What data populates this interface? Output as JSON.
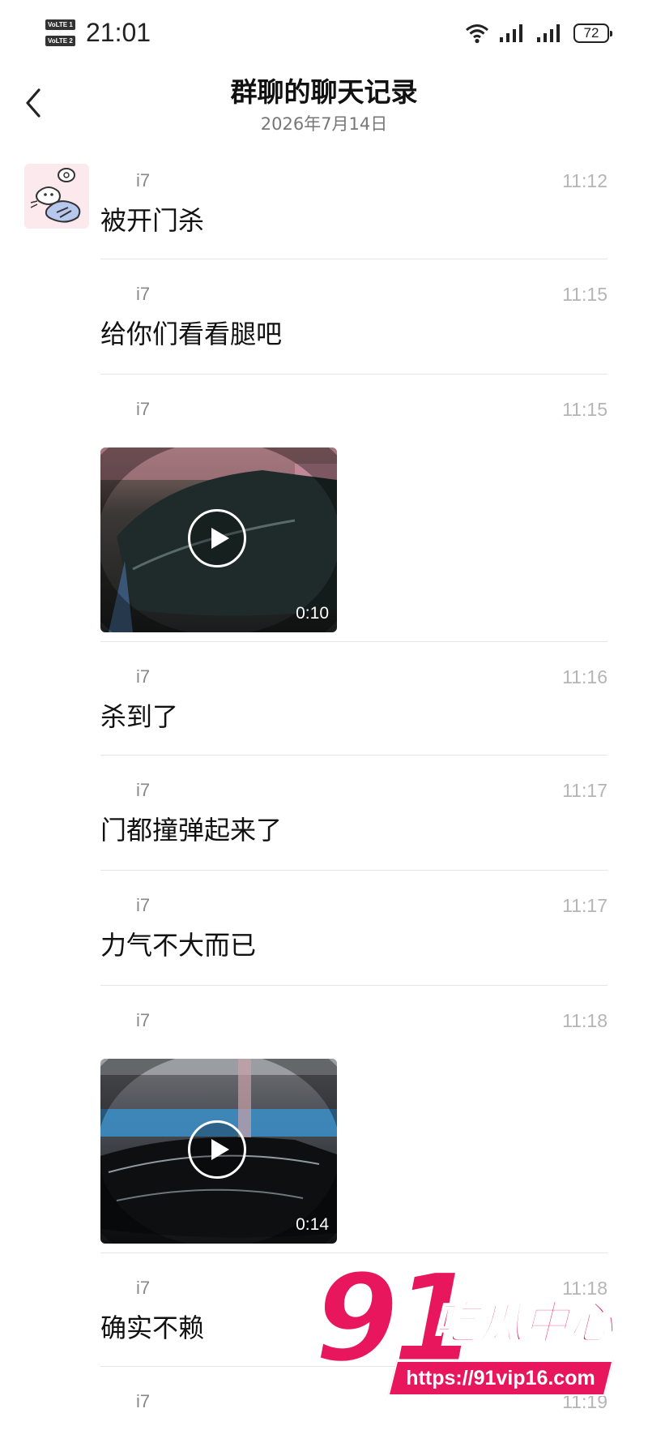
{
  "status_bar": {
    "time": "21:01",
    "sim1_label": "VoLTE 1",
    "sim2_label": "VoLTE 2",
    "battery": "72",
    "icons": [
      "wifi-icon",
      "signal-icon",
      "signal-icon",
      "battery-icon"
    ]
  },
  "header": {
    "title": "群聊的聊天记录",
    "subtitle": "2026年7月14日",
    "back_icon": "chevron-left-icon"
  },
  "messages": [
    {
      "type": "text",
      "sender": "i7",
      "time": "11:12",
      "text": "被开门杀"
    },
    {
      "type": "text",
      "sender": "i7",
      "time": "11:15",
      "text": "给你们看看腿吧"
    },
    {
      "type": "video",
      "sender": "i7",
      "time": "11:15",
      "duration": "0:10"
    },
    {
      "type": "text",
      "sender": "i7",
      "time": "11:16",
      "text": "杀到了"
    },
    {
      "type": "text",
      "sender": "i7",
      "time": "11:17",
      "text": "门都撞弹起来了"
    },
    {
      "type": "text",
      "sender": "i7",
      "time": "11:17",
      "text": "力气不大而已"
    },
    {
      "type": "video",
      "sender": "i7",
      "time": "11:18",
      "duration": "0:14"
    },
    {
      "type": "text",
      "sender": "i7",
      "time": "11:18",
      "text": "确实不赖"
    },
    {
      "type": "text",
      "sender": "i7",
      "time": "11:19",
      "text": ""
    }
  ],
  "watermark": {
    "number": "91",
    "name": "吃瓜中心",
    "url": "https://91vip16.com"
  },
  "colors": {
    "time_text": "#b5b5b5",
    "sender_text": "#888888",
    "divider": "#e6e6e6",
    "watermark": "#e8175d"
  }
}
